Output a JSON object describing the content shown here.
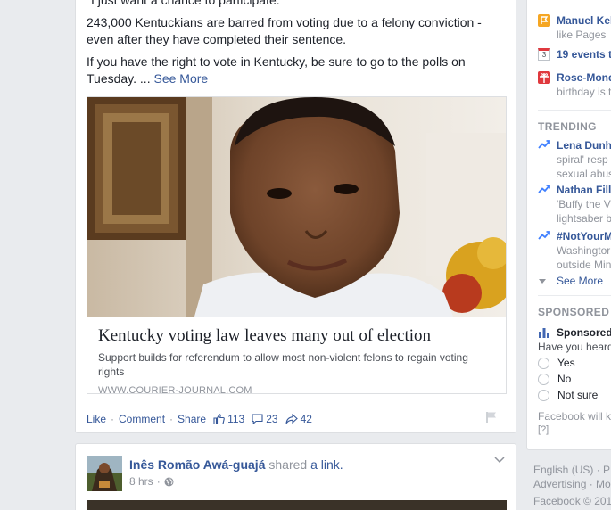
{
  "post1": {
    "quote": "\"I just want a chance to participate.\"",
    "paragraph1": "243,000 Kentuckians are barred from voting due to a felony conviction - even after they have completed their sentence.",
    "paragraph2": "If you have the right to vote in Kentucky, be sure to go to the polls on Tuesday. ...",
    "see_more": "See More",
    "link": {
      "title": "Kentucky voting law leaves many out of election",
      "description": "Support builds for referendum to allow most non-violent felons to regain voting rights",
      "domain": "WWW.COURIER-JOURNAL.COM"
    },
    "actions": {
      "like": "Like",
      "comment": "Comment",
      "share": "Share"
    },
    "stats": {
      "likes": "113",
      "comments": "23",
      "shares": "42"
    }
  },
  "post2": {
    "author": "Inês Romão Awá-guajá",
    "shared_text": "shared",
    "link_text": "a link.",
    "time": "8 hrs"
  },
  "sidebar": {
    "notifications": [
      {
        "main": "Manuel Kel",
        "sub": "like Pages",
        "icon": "page-icon"
      },
      {
        "main": "19 events t",
        "sub": "",
        "icon": "calendar-icon",
        "day": "3"
      },
      {
        "main": "Rose-Mond",
        "sub": "birthday is t",
        "icon": "gift-icon"
      }
    ],
    "trending_header": "TRENDING",
    "trending": [
      {
        "title": "Lena Dunh",
        "lines": [
          "spiral' resp",
          "sexual abus"
        ]
      },
      {
        "title": "Nathan Fill",
        "lines": [
          "'Buffy the V",
          "lightsaber b"
        ]
      },
      {
        "title": "#NotYourM",
        "lines": [
          "Washingtor",
          "outside Min"
        ]
      }
    ],
    "see_more": "See More",
    "sponsored_header": "SPONSORED",
    "poll": {
      "title": "Sponsored",
      "question": "Have you heard",
      "options": [
        "Yes",
        "No",
        "Not sure"
      ],
      "note": "Facebook will k",
      "note_link": "[?]"
    }
  },
  "footer": {
    "lang": "English (US) · P",
    "line2": "Advertising · Mo",
    "copyright": "Facebook © 201"
  },
  "colors": {
    "link": "#365899",
    "muted": "#90949c",
    "text": "#1d2129",
    "background": "#e9ebee"
  }
}
